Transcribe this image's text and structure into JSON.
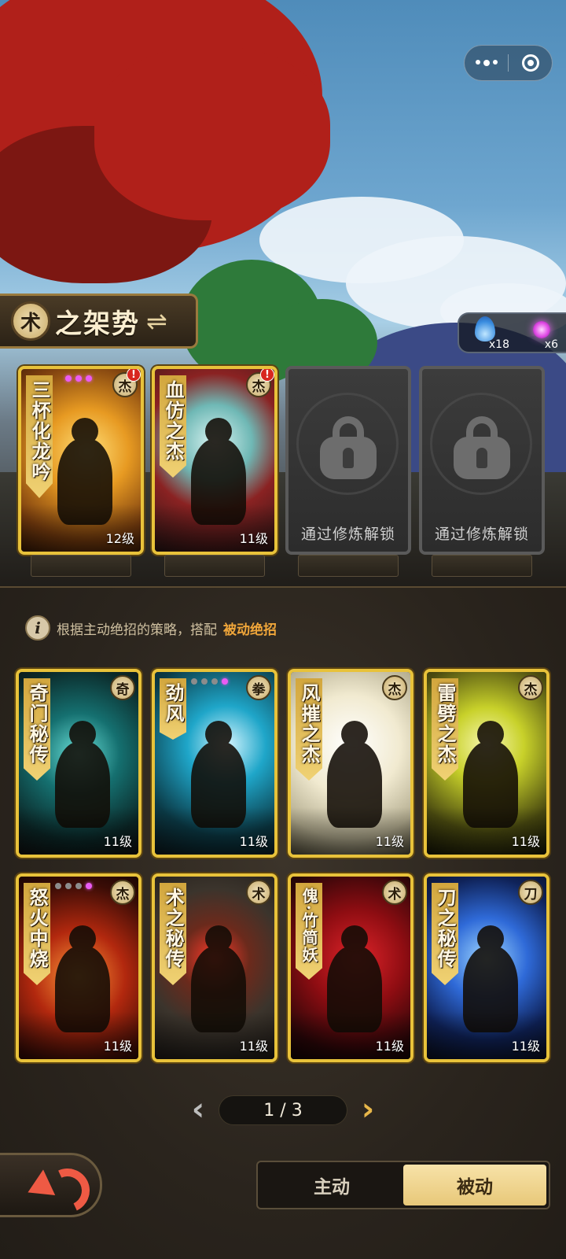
{
  "capsule": {
    "more_icon": "more-dots-icon",
    "close_icon": "target-icon"
  },
  "stance": {
    "badge": "术",
    "title": "之架势",
    "swap_icon": "⇌"
  },
  "resources": [
    {
      "icon": "blue-flame-icon",
      "count": "x18"
    },
    {
      "icon": "purple-orb-icon",
      "count": "x6"
    }
  ],
  "active_slots": [
    {
      "name": "三杯化龙吟",
      "level": "12级",
      "badge": "杰",
      "alert": "!",
      "gems": 3,
      "art": "art-gold"
    },
    {
      "name": "血仿之杰",
      "level": "11级",
      "badge": "杰",
      "alert": "!",
      "art": "art-blood"
    },
    {
      "locked": true,
      "label": "通过修炼解锁"
    },
    {
      "locked": true,
      "label": "通过修炼解锁"
    }
  ],
  "hint": {
    "icon": "i",
    "text": "根据主动绝招的策略，搭配",
    "highlight": "被动绝招"
  },
  "passive_cards": [
    {
      "name": "奇门秘传",
      "badge": "奇",
      "level": "11级",
      "art": "art-teal"
    },
    {
      "name": "劲风",
      "badge": "拳",
      "level": "11级",
      "art": "art-cyan",
      "gems": 1
    },
    {
      "name": "风摧之杰",
      "badge": "杰",
      "level": "11级",
      "art": "art-white"
    },
    {
      "name": "雷劈之杰",
      "badge": "杰",
      "level": "11级",
      "art": "art-yellow"
    },
    {
      "name": "怒火中烧",
      "badge": "杰",
      "level": "11级",
      "art": "art-fire",
      "gems": 1
    },
    {
      "name": "术之秘传",
      "badge": "术",
      "level": "11级",
      "art": "art-stone"
    },
    {
      "name": "傀·竹简妖",
      "badge": "术",
      "level": "11级",
      "art": "art-crimson"
    },
    {
      "name": "刀之秘传",
      "badge": "刀",
      "level": "11级",
      "art": "art-blue"
    }
  ],
  "pagination": {
    "prev": "‹",
    "current": "1 / 3",
    "next": "›"
  },
  "back_button": {
    "icon": "back-arrow-icon"
  },
  "toggle": {
    "active_label": "主动",
    "passive_label": "被动",
    "selected": "被动"
  },
  "colors": {
    "gold_frame": "#e8c23a",
    "accent_orange": "#f0a63a",
    "locked_gray": "#5a5a5a"
  }
}
